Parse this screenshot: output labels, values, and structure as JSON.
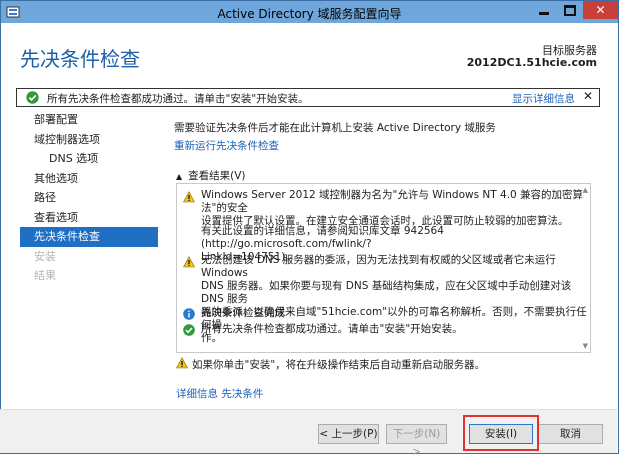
{
  "window": {
    "title": "Active Directory 域服务配置向导"
  },
  "header": {
    "page_title": "先决条件检查",
    "target_label": "目标服务器",
    "target_value": "2012DC1.51hcie.com"
  },
  "status_bar": {
    "text": "所有先决条件检查都成功通过。请单击\"安装\"开始安装。",
    "details_link": "显示详细信息",
    "close": "✕"
  },
  "nav": {
    "items": [
      {
        "label": "部署配置"
      },
      {
        "label": "域控制器选项"
      },
      {
        "label": "DNS 选项"
      },
      {
        "label": "其他选项"
      },
      {
        "label": "路径"
      },
      {
        "label": "查看选项"
      },
      {
        "label": "先决条件检查"
      },
      {
        "label": "安装"
      },
      {
        "label": "结果"
      }
    ]
  },
  "main": {
    "intro": "需要验证先决条件后才能在此计算机上安装 Active Directory 域服务",
    "rerun_link": "重新运行先决条件检查",
    "results_heading": "查看结果(V)",
    "results": [
      {
        "type": "warning",
        "lines": [
          "Windows Server 2012 域控制器为名为\"允许与 Windows NT 4.0 兼容的加密算法\"的安全",
          "设置提供了默认设置。在建立安全通道会话时，此设置可防止较弱的加密算法。"
        ]
      },
      {
        "type": "none",
        "lines": [
          "有关此设置的详细信息，请参阅知识库文章 942564 (http://go.microsoft.com/fwlink/?",
          "LinkId=104751)。"
        ]
      },
      {
        "type": "warning",
        "lines": [
          "无法创建该 DNS 服务器的委派，因为无法找到有权威的父区域或者它未运行 Windows",
          "DNS 服务器。如果你要与现有 DNS 基础结构集成，应在父区域中手动创建对该 DNS 服务",
          "器的委派，以确保来自域\"51hcie.com\"以外的可靠名称解析。否则，不需要执行任何操",
          "作。"
        ]
      },
      {
        "type": "info",
        "lines": [
          "先决条件检查完成"
        ]
      },
      {
        "type": "success",
        "lines": [
          "所有先决条件检查都成功通过。请单击\"安装\"开始安装。"
        ]
      }
    ],
    "bottom_warning": "如果你单击\"安装\"，将在升级操作结束后自动重新启动服务器。",
    "more_link": "详细信息 先决条件"
  },
  "footer": {
    "prev": "< 上一步(P)",
    "next": "下一步(N) >",
    "install": "安装(I)",
    "cancel": "取消"
  }
}
